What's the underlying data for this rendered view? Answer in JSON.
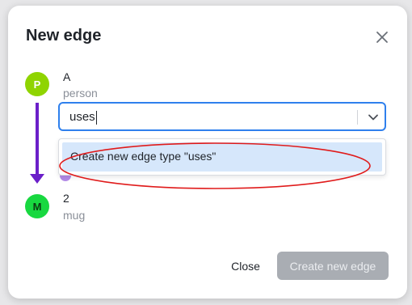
{
  "modal": {
    "title": "New edge",
    "close_icon": "close-icon"
  },
  "source_node": {
    "initial": "P",
    "name": "A",
    "type": "person",
    "color": "#8fd400"
  },
  "target_node": {
    "initial": "M",
    "name": "2",
    "type": "mug",
    "color": "#18d840"
  },
  "edge_arrow": {
    "color": "#6b1fc9",
    "icon": "arrow-down-icon"
  },
  "edge_type_select": {
    "value": "uses",
    "chevron_icon": "chevron-down-icon",
    "accent": "#2f80ed"
  },
  "dropdown": {
    "options": [
      {
        "label": "Create new edge type \"uses\"",
        "highlighted": true
      }
    ]
  },
  "annotation": {
    "color": "#e01b1b"
  },
  "footer": {
    "close_label": "Close",
    "create_label": "Create new edge",
    "create_disabled": true
  }
}
